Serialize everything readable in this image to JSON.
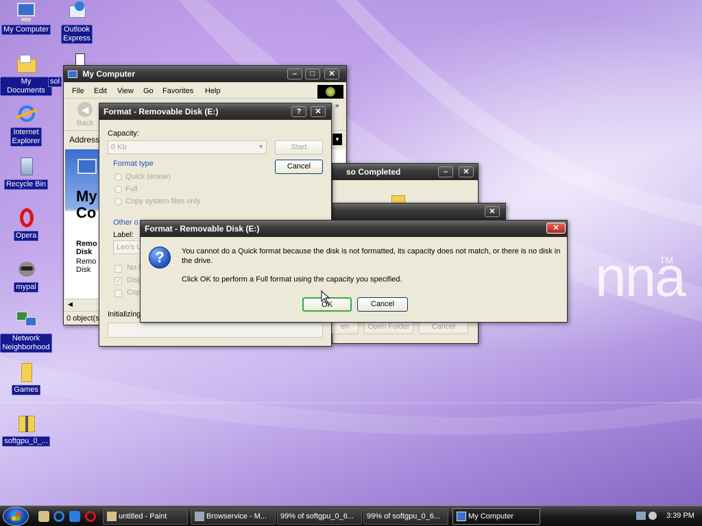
{
  "desktop": {
    "wallpaper_text": "nna",
    "wallpaper_tm": "TM",
    "icons": [
      {
        "label": "My Computer"
      },
      {
        "label": "Outlook\nExpress"
      },
      {
        "label": "My Documents"
      },
      {
        "label": "sol"
      },
      {
        "label": "Internet\nExplorer"
      },
      {
        "label": "Recycle Bin"
      },
      {
        "label": "Opera"
      },
      {
        "label": "mypal"
      },
      {
        "label": "Network\nNeighborhood"
      },
      {
        "label": "Games"
      },
      {
        "label": "softgpu_0_..."
      }
    ]
  },
  "my_computer": {
    "title": "My Computer",
    "menu": [
      "File",
      "Edit",
      "View",
      "Go",
      "Favorites",
      "Help"
    ],
    "back_label": "Back",
    "address_label": "Address",
    "content_heading_1": "My",
    "content_heading_2": "Co",
    "content_removable": "Remo\nDisk",
    "content_removable_sub": "Remo\nDisk",
    "status": "0 object(s)"
  },
  "format_behind": {
    "title": "Format - Removable Disk (E:)",
    "capacity_label": "Capacity:",
    "capacity_value": "0 Kb",
    "start_label": "Start",
    "cancel_label": "Cancel",
    "format_type_title": "Format type",
    "quick_label": "Quick (erase)",
    "full_label": "Full",
    "copy_sys_label": "Copy system files only",
    "other_title": "Other o",
    "label_label": "Label:",
    "label_value": "Leo's U",
    "opt1": "No l",
    "opt2": "Disp",
    "opt3": "Cop",
    "status": "Initializing"
  },
  "download_win": {
    "title": "so Completed",
    "open_label": "en",
    "open_folder_label": "Open Folder",
    "cancel_label": "Cancel"
  },
  "dialog": {
    "title": "Format - Removable Disk (E:)",
    "message_1": "You cannot do a Quick format because the disk is not formatted, its capacity does not match, or there is no disk in the drive.",
    "message_2": "Click OK to perform a Full format using the capacity you specified.",
    "ok_label": "OK",
    "cancel_label": "Cancel"
  },
  "taskbar": {
    "tasks": [
      {
        "label": "untitled - Paint"
      },
      {
        "label": "Browservice - M..."
      },
      {
        "label": "99% of softgpu_0_6..."
      },
      {
        "label": "99% of softgpu_0_6..."
      },
      {
        "label": "My Computer"
      }
    ],
    "clock": "3:39 PM"
  }
}
